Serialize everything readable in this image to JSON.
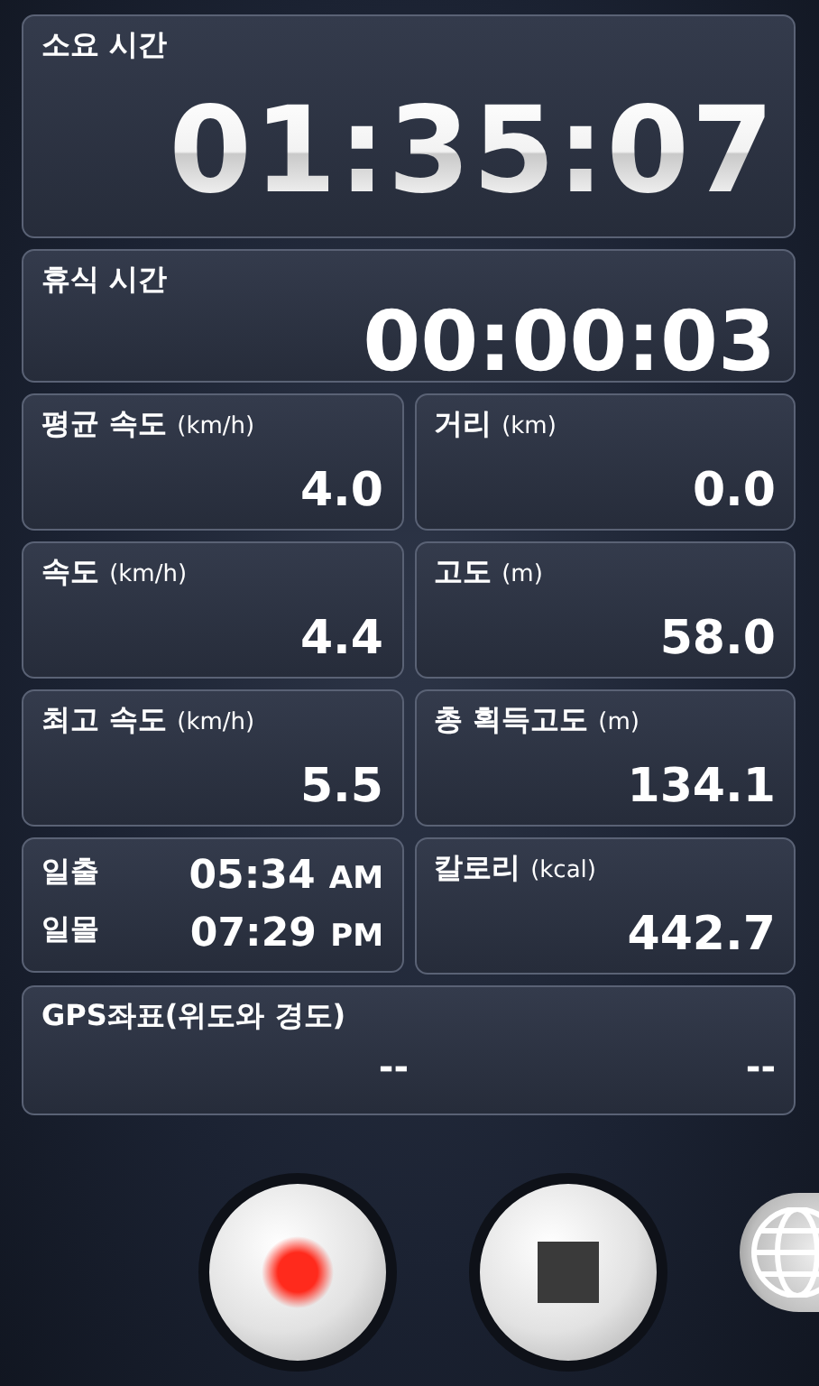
{
  "elapsed": {
    "label": "소요 시간",
    "value": "01:35:07"
  },
  "rest": {
    "label": "휴식 시간",
    "value": "00:00:03"
  },
  "stats": [
    {
      "kind": "value",
      "label": "평균 속도",
      "unit": "(km/h)",
      "value": "4.0"
    },
    {
      "kind": "value",
      "label": "거리",
      "unit": "(km)",
      "value": "0.0"
    },
    {
      "kind": "value",
      "label": "속도",
      "unit": "(km/h)",
      "value": "4.4"
    },
    {
      "kind": "value",
      "label": "고도",
      "unit": "(m)",
      "value": "58.0"
    },
    {
      "kind": "value",
      "label": "최고 속도",
      "unit": "(km/h)",
      "value": "5.5"
    },
    {
      "kind": "value",
      "label": "총 획득고도",
      "unit": "(m)",
      "value": "134.1"
    },
    {
      "kind": "sun",
      "rows": [
        {
          "label": "일출",
          "time": "05:34",
          "suffix": "AM"
        },
        {
          "label": "일몰",
          "time": "07:29",
          "suffix": "PM"
        }
      ]
    },
    {
      "kind": "value",
      "label": "칼로리",
      "unit": "(kcal)",
      "value": "442.7"
    }
  ],
  "gps": {
    "label": "GPS좌표(위도와 경도)",
    "latitude": "--",
    "longitude": "--"
  },
  "controls": [
    {
      "kind": "record"
    },
    {
      "kind": "stop"
    },
    {
      "kind": "globe"
    }
  ]
}
